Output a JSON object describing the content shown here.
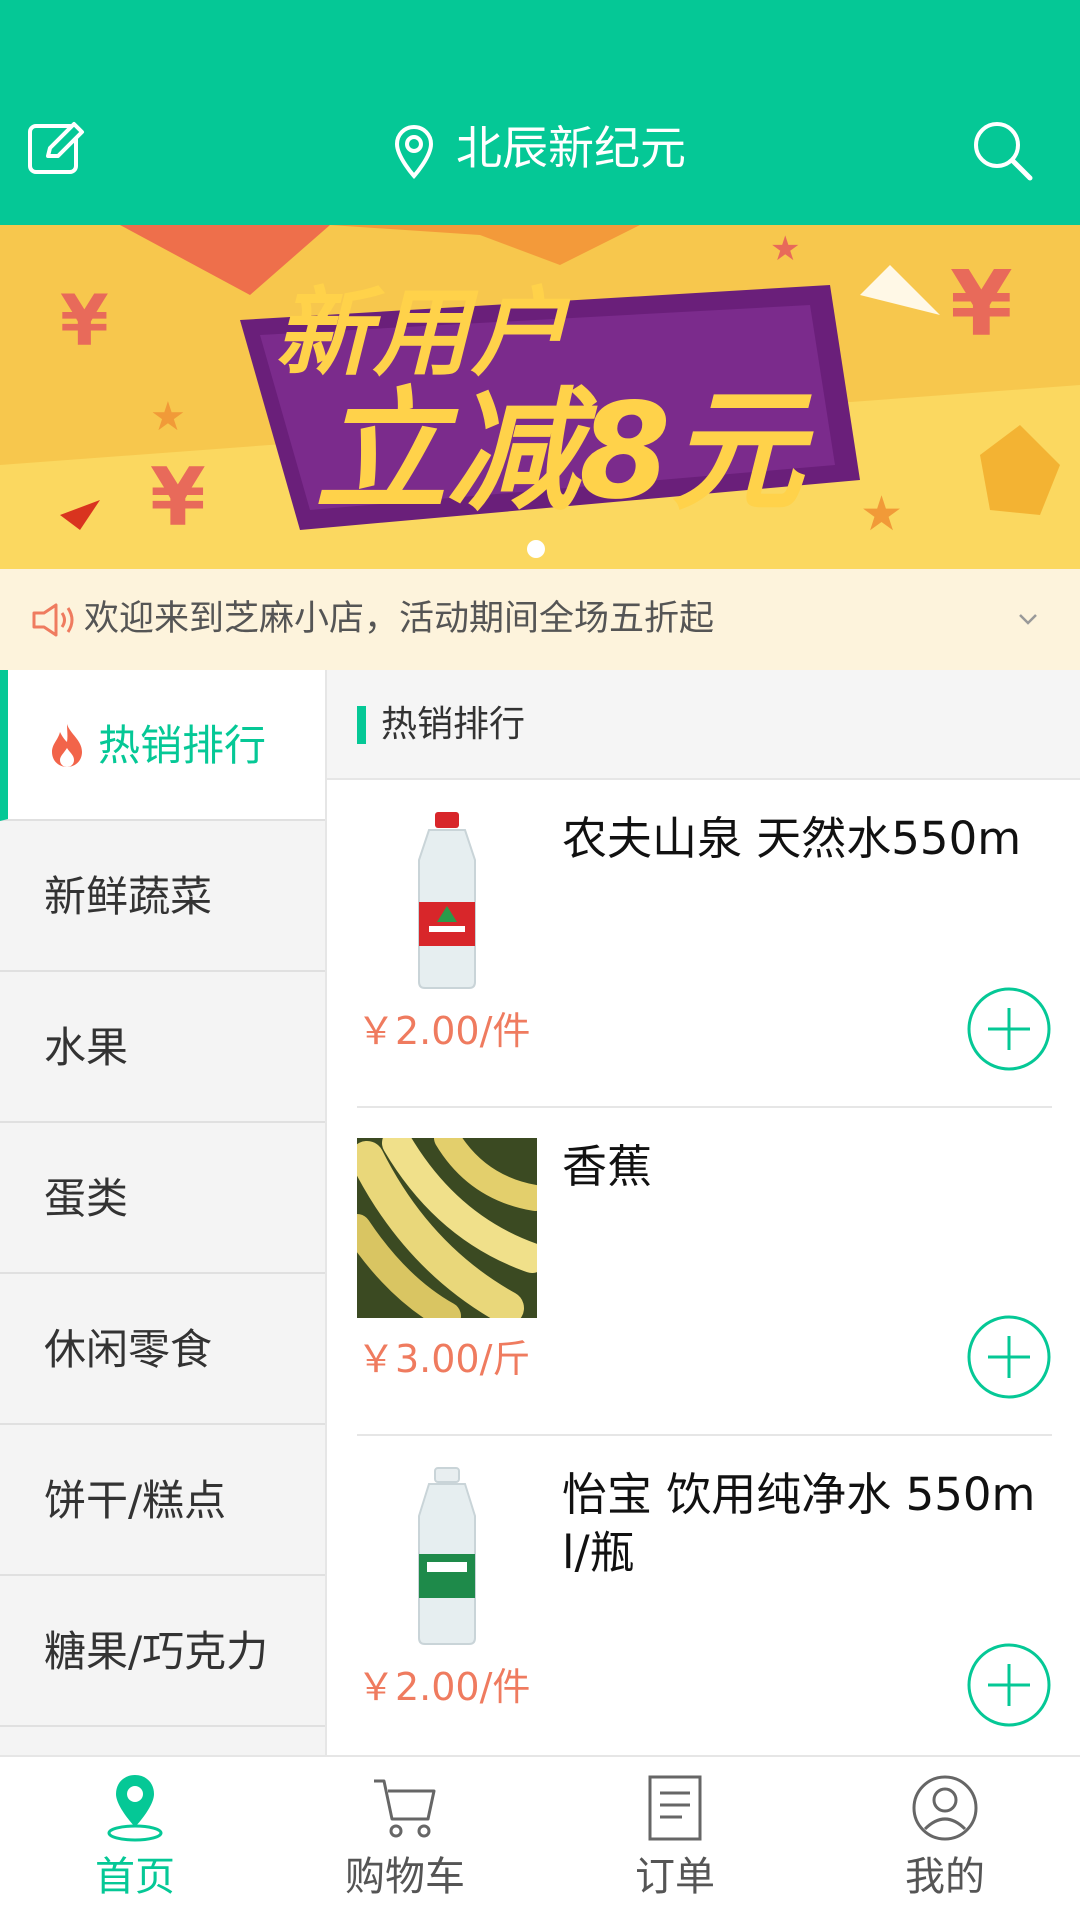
{
  "header": {
    "location": "北辰新纪元"
  },
  "banner": {
    "line1": "新用户",
    "line2": "立减8元"
  },
  "notice": {
    "text": "欢迎来到芝麻小店，活动期间全场五折起"
  },
  "sidebar": {
    "items": [
      {
        "label": "热销排行"
      },
      {
        "label": "新鲜蔬菜"
      },
      {
        "label": "水果"
      },
      {
        "label": "蛋类"
      },
      {
        "label": "休闲零食"
      },
      {
        "label": "饼干/糕点"
      },
      {
        "label": "糖果/巧克力"
      }
    ]
  },
  "content": {
    "section_title": "热销排行",
    "products": [
      {
        "name": "农夫山泉 天然水550m",
        "price": "￥2.00/件"
      },
      {
        "name": "香蕉",
        "price": "￥3.00/斤"
      },
      {
        "name": "怡宝 饮用纯净水 550ml/瓶",
        "price": "￥2.00/件"
      }
    ]
  },
  "tabbar": {
    "tabs": [
      {
        "label": "首页"
      },
      {
        "label": "购物车"
      },
      {
        "label": "订单"
      },
      {
        "label": "我的"
      }
    ]
  },
  "colors": {
    "primary": "#05c896",
    "price": "#ef7b5f",
    "notice_bg": "#fdf3dc",
    "banner_purple": "#6a1f7a",
    "banner_yellow": "#ffd24a"
  }
}
